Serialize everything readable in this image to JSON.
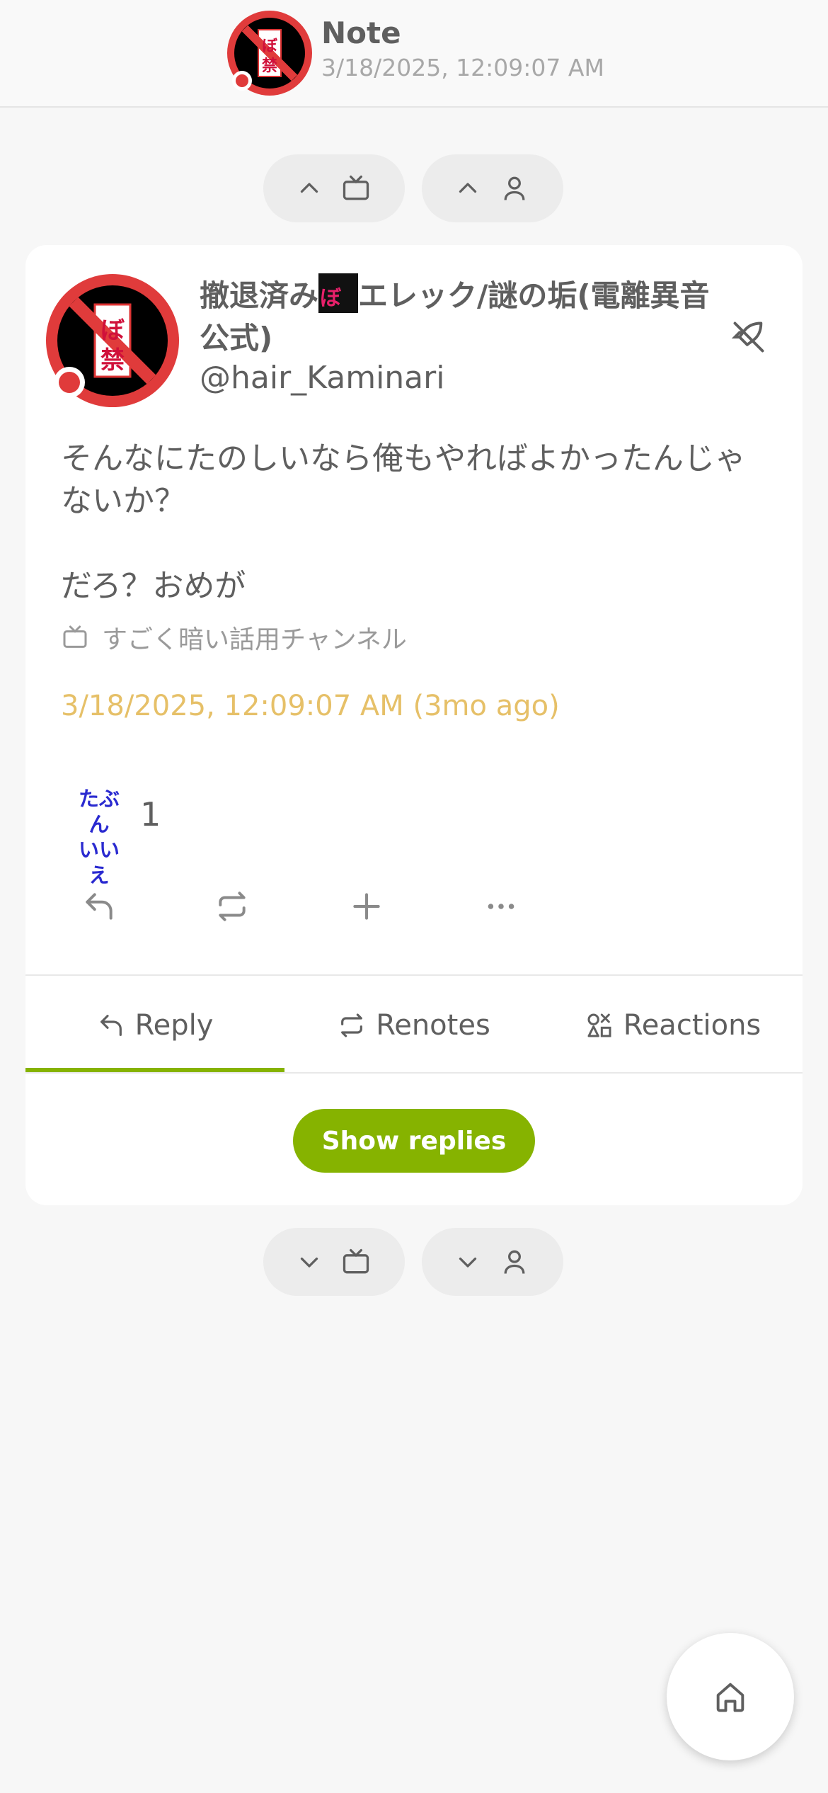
{
  "header": {
    "title": "Note",
    "subtitle": "3/18/2025, 12:09:07 AM"
  },
  "nav_top": {
    "prev_channel_icon": "chevron-up + tv-icon",
    "prev_user_icon": "chevron-up + user-icon"
  },
  "note": {
    "author_name_before": "撤退済み",
    "author_name_after": "エレック/謎の垢(電離異音公式)",
    "author_emoji_text": "ぼ禁",
    "author_handle": "@hair_Kaminari",
    "text": "そんなにたのしいなら俺もやればよかったんじゃないか？\n\nだろ？おめが",
    "channel": "すごく暗い話用チャンネル",
    "timestamp": "3/18/2025, 12:09:07 AM (3mo ago)",
    "reaction_emoji_line1": "たぶん",
    "reaction_emoji_line2": "いいえ",
    "reaction_count": "1"
  },
  "tabs": {
    "reply": "Reply",
    "renotes": "Renotes",
    "reactions": "Reactions"
  },
  "show_replies_label": "Show replies",
  "colors": {
    "accent": "#86b300",
    "timestamp": "#e6c068",
    "avatar_ring": "#e03b3b"
  }
}
